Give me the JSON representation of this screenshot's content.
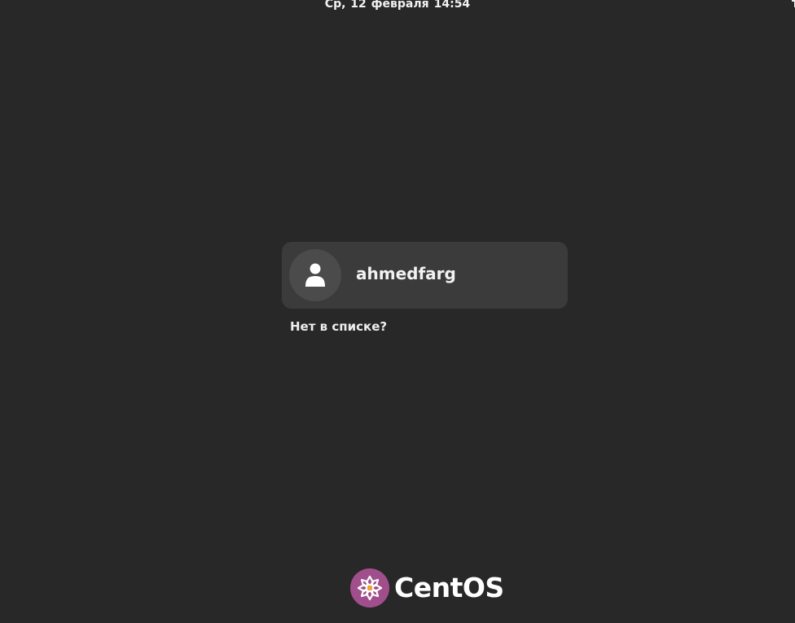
{
  "top_bar": {
    "date": "Ср, 12 февраля",
    "time": "14:54"
  },
  "user_list": {
    "users": [
      {
        "username": "ahmedfarg",
        "avatar_icon": "user-silhouette-icon"
      }
    ],
    "not_listed_label": "Нет в списке?"
  },
  "branding": {
    "name": "CentOS",
    "logo_icon": "centos-logo-icon",
    "logo_color": "#a14f8c"
  },
  "theme": {
    "background": "#282828",
    "card": "#3b3b3b",
    "avatar_bg": "#4b4b4b"
  }
}
